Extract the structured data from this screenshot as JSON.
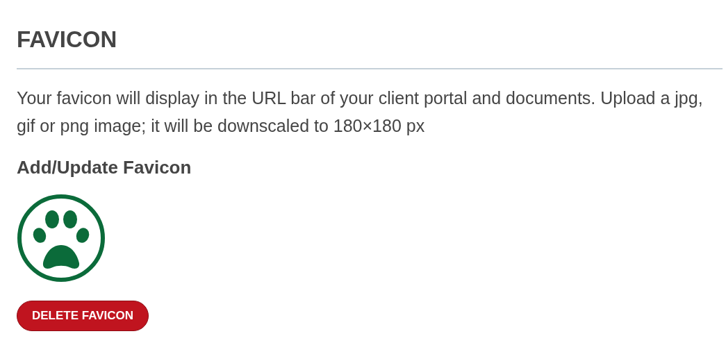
{
  "section": {
    "title": "FAVICON",
    "description": "Your favicon will display in the URL bar of your client portal and documents. Upload a jpg, gif or png image; it will be downscaled to 180×180 px",
    "subtitle": "Add/Update Favicon",
    "preview": {
      "kind": "paw"
    },
    "delete_button": "DELETE FAVICON"
  }
}
